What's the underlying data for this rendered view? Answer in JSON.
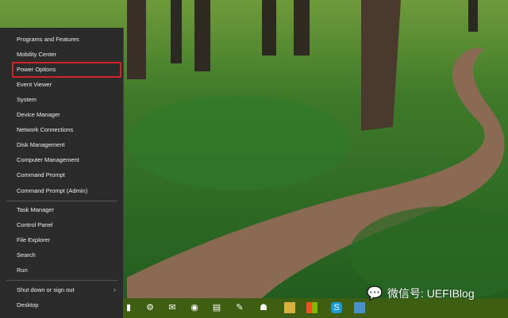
{
  "context_menu": {
    "group1": [
      "Programs and Features",
      "Mobility Center",
      "Power Options",
      "Event Viewer",
      "System",
      "Device Manager",
      "Network Connections",
      "Disk Management",
      "Computer Management",
      "Command Prompt",
      "Command Prompt (Admin)"
    ],
    "group2": [
      "Task Manager",
      "Control Panel",
      "File Explorer",
      "Search",
      "Run"
    ],
    "group3": [
      "Shut down or sign out",
      "Desktop"
    ],
    "highlighted": "Power Options",
    "highlight_color": "#d0232a"
  },
  "submenu_arrow": "›",
  "taskbar": {
    "icons": [
      "store-icon",
      "settings-icon",
      "mail-icon",
      "camera-icon",
      "video-icon",
      "brush-icon",
      "people-icon",
      "file-explorer-icon",
      "windows-logo-icon",
      "skype-icon",
      "display-icon"
    ]
  },
  "watermark": {
    "text": "微信号: UEFIBlog"
  }
}
